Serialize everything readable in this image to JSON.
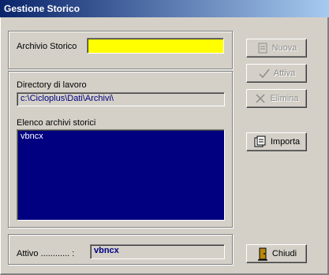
{
  "window": {
    "title": "Gestione Storico"
  },
  "archive": {
    "label": "Archivio Storico",
    "value": ""
  },
  "workdir": {
    "label": "Directory di lavoro",
    "value": "c:\\Cicloplus\\Dati\\Archivi\\"
  },
  "list": {
    "label": "Elenco archivi storici",
    "items": [
      "vbncx"
    ]
  },
  "active": {
    "label": "Attivo ............ :",
    "value": "vbncx"
  },
  "buttons": {
    "nuova": "Nuova",
    "attiva": "Attiva",
    "elimina": "Elimina",
    "importa": "Importa",
    "chiudi": "Chiudi"
  },
  "colors": {
    "archive_field_bg": "#ffff00",
    "list_bg": "#000080",
    "list_text": "#ffffff",
    "active_text": "#000080"
  },
  "icons": {
    "nuova": "new-doc-icon",
    "attiva": "checkmark-icon",
    "elimina": "delete-icon",
    "importa": "import-icon",
    "chiudi": "door-exit-icon"
  }
}
